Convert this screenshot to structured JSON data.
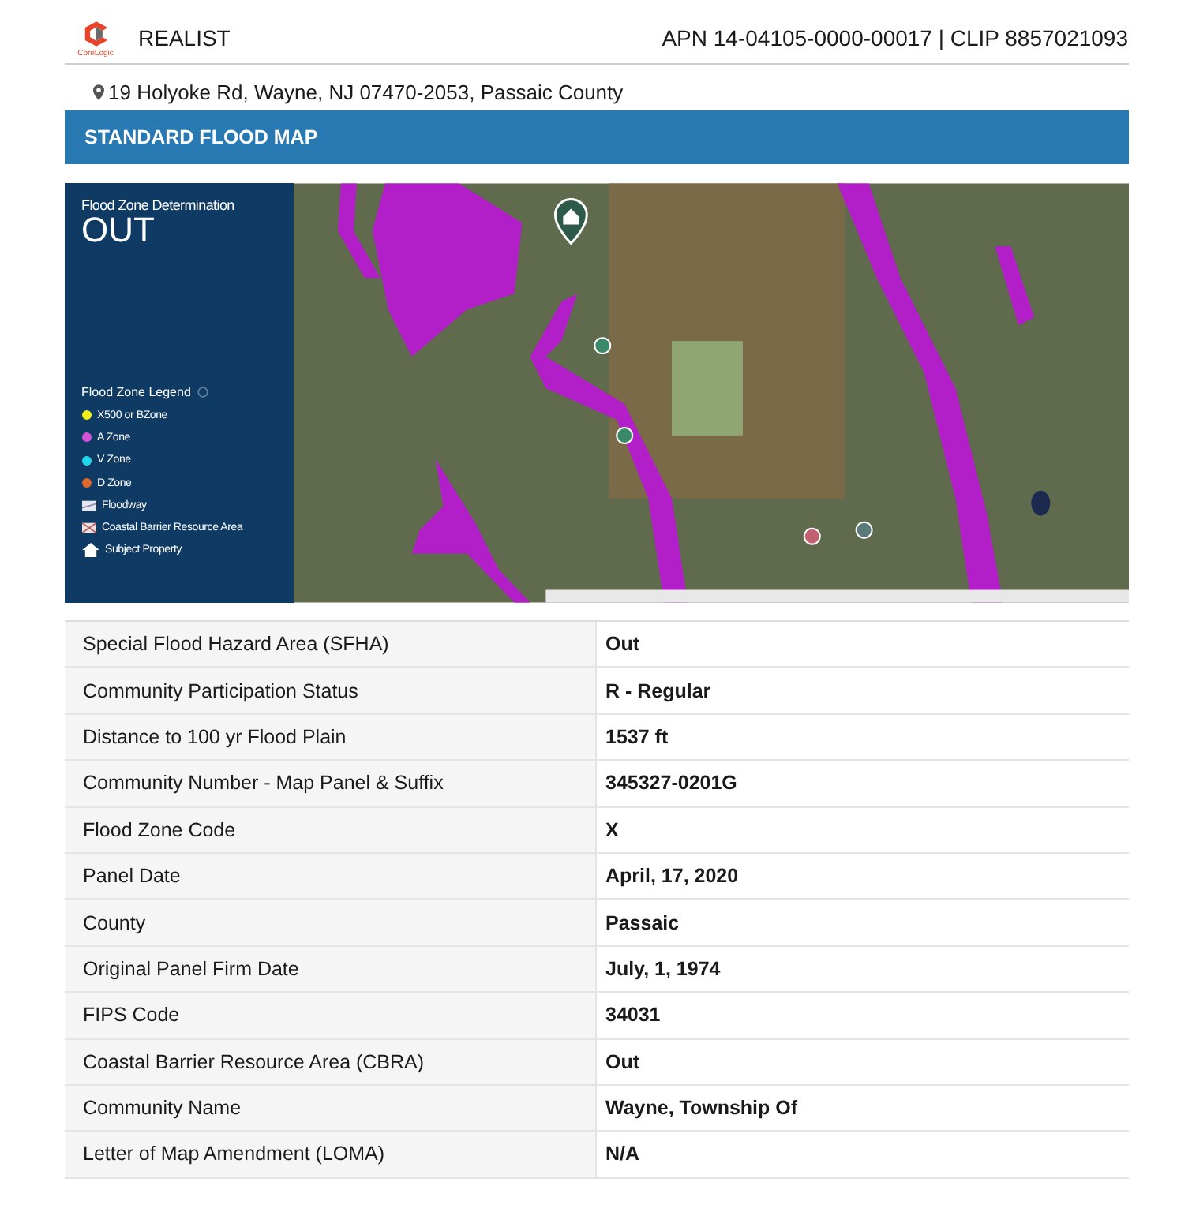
{
  "header": {
    "brand": "REALIST",
    "logo_caption": "CoreLogic",
    "ids": "APN 14-04105-0000-00017 | CLIP 8857021093"
  },
  "address": "19 Holyoke Rd, Wayne, NJ 07470-2053, Passaic County",
  "section": {
    "title": "STANDARD FLOOD MAP"
  },
  "flood_panel": {
    "determination_label": "Flood Zone Determination",
    "determination_value": "OUT",
    "legend_title": "Flood Zone Legend",
    "legend": [
      {
        "kind": "dot",
        "label": "X500 or BZone",
        "color": "#f2ee1c"
      },
      {
        "kind": "dot",
        "label": "A Zone",
        "color": "#d454d8"
      },
      {
        "kind": "dot",
        "label": "V Zone",
        "color": "#22d6ec"
      },
      {
        "kind": "dot",
        "label": "D Zone",
        "color": "#e0682a"
      },
      {
        "kind": "floodway",
        "label": "Floodway"
      },
      {
        "kind": "barrier",
        "label": "Coastal Barrier Resource Area"
      },
      {
        "kind": "property",
        "label": "Subject Property"
      }
    ]
  },
  "table": {
    "rows": [
      {
        "label": "Special Flood Hazard Area (SFHA)",
        "value": "Out"
      },
      {
        "label": "Community Participation Status",
        "value": "R - Regular"
      },
      {
        "label": "Distance to 100 yr Flood Plain",
        "value": "1537 ft"
      },
      {
        "label": "Community Number - Map Panel & Suffix",
        "value": "345327-0201G"
      },
      {
        "label": "Flood Zone Code",
        "value": "X"
      },
      {
        "label": "Panel Date",
        "value": "April, 17, 2020"
      },
      {
        "label": "County",
        "value": "Passaic"
      },
      {
        "label": "Original Panel Firm Date",
        "value": "July, 1, 1974"
      },
      {
        "label": "FIPS Code",
        "value": "34031"
      },
      {
        "label": "Coastal Barrier Resource Area (CBRA)",
        "value": "Out"
      },
      {
        "label": "Community Name",
        "value": "Wayne, Township Of"
      },
      {
        "label": "Letter of Map Amendment (LOMA)",
        "value": "N/A"
      }
    ]
  }
}
